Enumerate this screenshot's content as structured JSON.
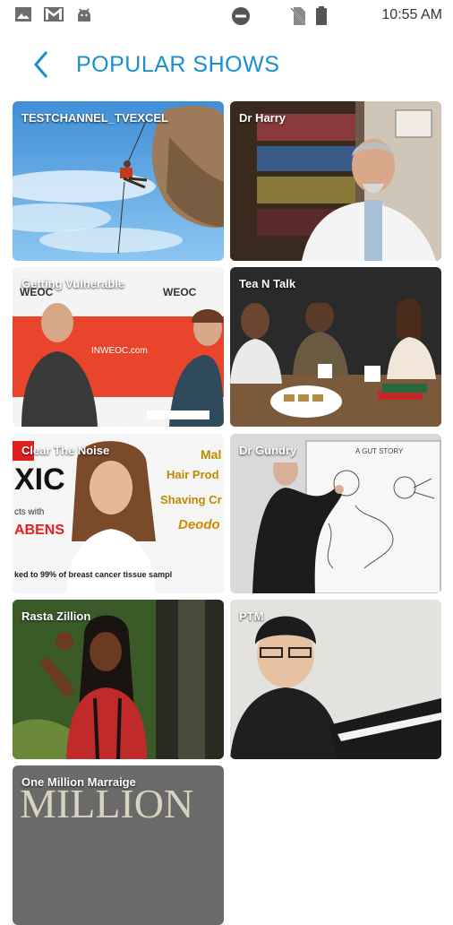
{
  "status_bar": {
    "time": "10:55 AM",
    "icons": [
      "image-icon",
      "gmail-icon",
      "android-icon",
      "do-not-disturb-icon",
      "no-sim-icon",
      "battery-icon"
    ]
  },
  "header": {
    "title": "POPULAR SHOWS",
    "back_icon": "chevron-left-icon",
    "accent_color": "#1a8fd0"
  },
  "shows": [
    {
      "label": "TESTCHANNEL_TVEXCEL"
    },
    {
      "label": "Dr Harry"
    },
    {
      "label": "Getting Vulnerable"
    },
    {
      "label": "Tea N Talk"
    },
    {
      "label": "Clear The Noise"
    },
    {
      "label": "Dr Gundry"
    },
    {
      "label": "Rasta Zillion"
    },
    {
      "label": "PTM"
    },
    {
      "label": "One Million Marraige"
    }
  ],
  "thumb_text": {
    "weoc_left": "WEOC",
    "weoc_right": "WEOC",
    "weoc_url": "INWEOC.com",
    "noise_1": "XIC",
    "noise_2": "ABENS",
    "noise_3": "cts with",
    "noise_4": "Hair Prod",
    "noise_5": "Shaving Cr",
    "noise_6": "Deodo",
    "noise_7": "Mal",
    "noise_8": "ked to 99% of breast cancer tissue sampl",
    "board": "A GUT STORY",
    "million": "MILLION"
  }
}
